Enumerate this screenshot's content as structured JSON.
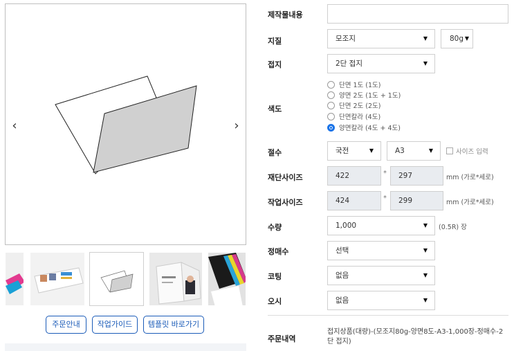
{
  "carousel": {
    "prev_icon": "‹",
    "next_icon": "›"
  },
  "guide_buttons": [
    {
      "label": "주문안내"
    },
    {
      "label": "작업가이드"
    },
    {
      "label": "템플릿 바로가기"
    }
  ],
  "form": {
    "content": {
      "label": "제작물내용",
      "value": ""
    },
    "paper": {
      "label": "지질",
      "value": "모조지",
      "weight": "80g"
    },
    "fold": {
      "label": "접지",
      "value": "2단 접지"
    },
    "color": {
      "label": "색도",
      "options": [
        "단면 1도 (1도)",
        "양면 2도 (1도 + 1도)",
        "단면 2도 (2도)",
        "단면칼라 (4도)",
        "양면칼라 (4도 + 4도)"
      ],
      "selected": 4
    },
    "size": {
      "label": "절수",
      "value1": "국전",
      "value2": "A3",
      "custom_label": "사이즈 입력"
    },
    "cut_size": {
      "label": "재단사이즈",
      "width": "422",
      "height": "297",
      "unit": "mm (가로*세로)",
      "sep": "*"
    },
    "work_size": {
      "label": "작업사이즈",
      "width": "424",
      "height": "299",
      "unit": "mm (가로*세로)",
      "sep": "*"
    },
    "quantity": {
      "label": "수량",
      "value": "1,000",
      "note": "(0.5R) 장"
    },
    "sheets": {
      "label": "정매수",
      "value": "선택"
    },
    "coating": {
      "label": "코팅",
      "value": "없음"
    },
    "scoring": {
      "label": "오시",
      "value": "없음"
    }
  },
  "summary": {
    "label": "주문내역",
    "text": "접지상품(대량)-(모조지80g-양면8도-A3-1,000장-정매수-2단 접지)"
  },
  "colors": {
    "accent": "#1a5bb8",
    "radio_on": "#1a73e8",
    "gray_field": "#e9ecf0"
  }
}
